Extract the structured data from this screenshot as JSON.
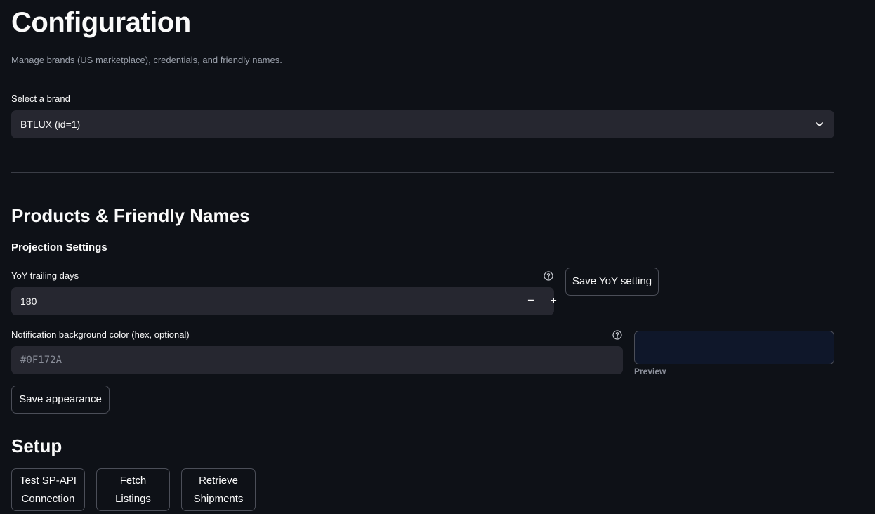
{
  "page": {
    "title": "Configuration",
    "subtitle": "Manage brands (US marketplace), credentials, and friendly names."
  },
  "brand_select": {
    "label": "Select a brand",
    "value": "BTLUX (id=1)",
    "icon": "chevron-down-icon"
  },
  "products_section": {
    "heading": "Products & Friendly Names",
    "subheading": "Projection Settings"
  },
  "yoy": {
    "label": "YoY trailing days",
    "value": "180",
    "minus": "−",
    "plus": "+",
    "save_label": "Save YoY setting"
  },
  "notification": {
    "label": "Notification background color (hex, optional)",
    "placeholder": "#0F172A",
    "preview_label": "Preview",
    "preview_color": "#0f172a"
  },
  "appearance": {
    "save_label": "Save appearance"
  },
  "setup": {
    "heading": "Setup",
    "buttons": [
      {
        "line1": "Test SP-API",
        "line2": "Connection"
      },
      {
        "line1": "Fetch",
        "line2": "Listings"
      },
      {
        "line1": "Retrieve",
        "line2": "Shipments"
      }
    ]
  },
  "colors": {
    "background": "#0e1117",
    "input_bg": "#262730",
    "border": "#4b4e58"
  }
}
